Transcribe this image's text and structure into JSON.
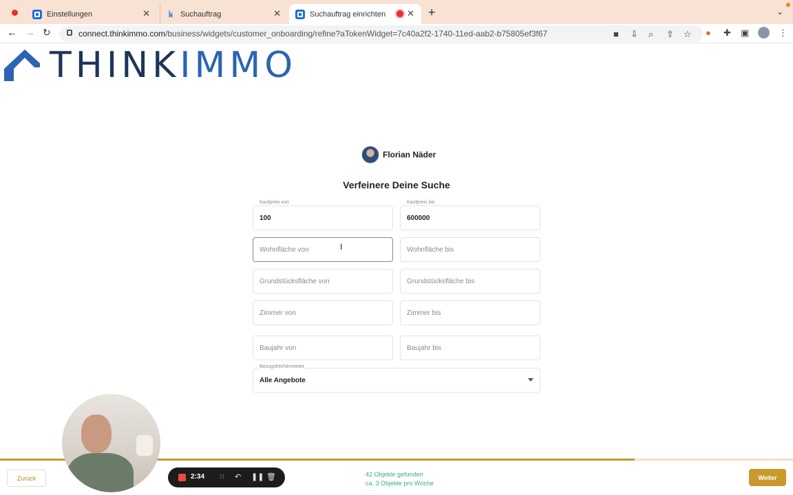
{
  "browser": {
    "tabs": [
      {
        "title": "Einstellungen",
        "active": false
      },
      {
        "title": "Suchauftrag",
        "active": false
      },
      {
        "title": "Suchauftrag einrichten",
        "active": true
      }
    ],
    "url_host": "connect.thinkimmo.com",
    "url_path": "/business/widgets/customer_onboarding/refine?aTokenWidget=7c40a2f2-1740-11ed-aab2-b75805ef3f67"
  },
  "logo": {
    "part1": "THINK",
    "part2": "IMMO",
    "brand_color": "#1d3557",
    "accent_color": "#2b64b3"
  },
  "agent": {
    "name": "Florian Näder"
  },
  "form": {
    "heading": "Verfeinere Deine Suche",
    "kaufpreis_von": {
      "label": "Kaufpreis von",
      "value": "100"
    },
    "kaufpreis_bis": {
      "label": "Kaufpreis bis",
      "value": "600000"
    },
    "wohnflaeche_von": {
      "placeholder": "Wohnfläche von"
    },
    "wohnflaeche_bis": {
      "placeholder": "Wohnfläche bis"
    },
    "grund_von": {
      "placeholder": "Grundstücksfläche von"
    },
    "grund_bis": {
      "placeholder": "Grundstücksfläche bis"
    },
    "zimmer_von": {
      "placeholder": "Zimmer von"
    },
    "zimmer_bis": {
      "placeholder": "Zimmer bis"
    },
    "baujahr_von": {
      "placeholder": "Baujahr von"
    },
    "baujahr_bis": {
      "placeholder": "Baujahr bis"
    },
    "bezug": {
      "label": "Bezugsfrei/Vermietet",
      "value": "Alle Angebote"
    }
  },
  "footer": {
    "back_label": "Zurück",
    "next_label": "Weiter",
    "found_line1": "42 Objekte gefunden",
    "found_line2": "ca. 3 Objekte pro Woche",
    "progress_fraction": 0.8,
    "accent_color": "#c89a2c",
    "status_color": "#3cab8e"
  },
  "recorder": {
    "time": "2:34"
  }
}
